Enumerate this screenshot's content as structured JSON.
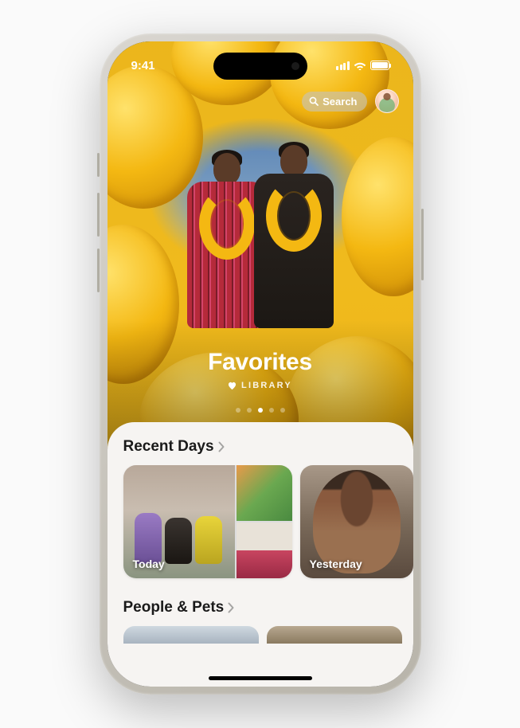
{
  "status": {
    "time": "9:41"
  },
  "search": {
    "label": "Search"
  },
  "hero": {
    "title": "Favorites",
    "subtitle": "LIBRARY"
  },
  "pagination": {
    "count": 5,
    "active_index": 2
  },
  "sections": {
    "recent_days": {
      "title": "Recent Days",
      "items": [
        {
          "label": "Today"
        },
        {
          "label": "Yesterday"
        }
      ]
    },
    "people_pets": {
      "title": "People & Pets"
    }
  }
}
